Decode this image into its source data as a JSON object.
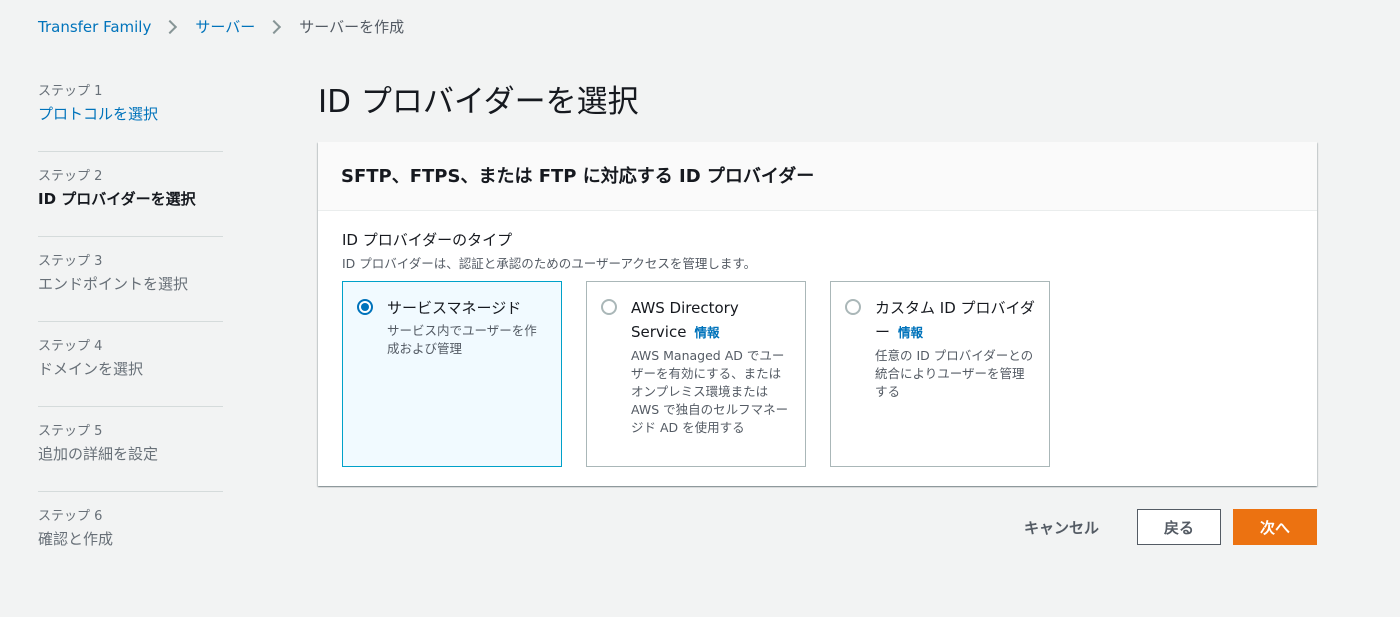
{
  "breadcrumb": {
    "item1": "Transfer Family",
    "item2": "サーバー",
    "current": "サーバーを作成"
  },
  "steps": [
    {
      "num": "ステップ 1",
      "label": "プロトコルを選択"
    },
    {
      "num": "ステップ 2",
      "label": "ID プロバイダーを選択"
    },
    {
      "num": "ステップ 3",
      "label": "エンドポイントを選択"
    },
    {
      "num": "ステップ 4",
      "label": "ドメインを選択"
    },
    {
      "num": "ステップ 5",
      "label": "追加の詳細を設定"
    },
    {
      "num": "ステップ 6",
      "label": "確認と作成"
    }
  ],
  "page_title": "ID プロバイダーを選択",
  "panel": {
    "title": "SFTP、FTPS、または FTP に対応する ID プロバイダー",
    "field_label": "ID プロバイダーのタイプ",
    "field_desc": "ID プロバイダーは、認証と承認のためのユーザーアクセスを管理します。",
    "tiles": [
      {
        "title": "サービスマネージド",
        "info": "",
        "desc": "サービス内でユーザーを作成および管理"
      },
      {
        "title": "AWS Directory Service",
        "info": "情報",
        "desc": "AWS Managed AD でユーザーを有効にする、またはオンプレミス環境または AWS で独自のセルフマネージド AD を使用する"
      },
      {
        "title": "カスタム ID プロバイダー",
        "info": "情報",
        "desc": "任意の ID プロバイダーとの統合によりユーザーを管理する"
      }
    ]
  },
  "actions": {
    "cancel": "キャンセル",
    "back": "戻る",
    "next": "次へ"
  },
  "colors": {
    "link": "#0073bb",
    "primary": "#ec7211",
    "selected_bg": "#f1faff"
  }
}
